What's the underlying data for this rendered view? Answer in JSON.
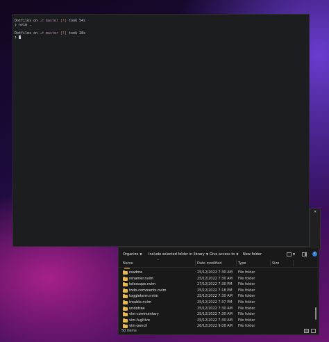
{
  "terminal": {
    "line1": {
      "dir": "Dotfiles",
      "on": " on ",
      "git": "⎇ master",
      "status": " [!]",
      "took": " took 54s"
    },
    "line2": {
      "prompt": "❯",
      "cmd": " nvim ."
    },
    "line3": {
      "dir": "Dotfiles",
      "on": " on ",
      "git": "⎇ master",
      "status": " [!]",
      "took": " took 28s"
    },
    "line4": {
      "prompt": "❯"
    }
  },
  "explorer": {
    "toolbar": {
      "organize": "Organize",
      "include": "Include selected folder in library",
      "share": "Give access to",
      "new_folder": "New folder"
    },
    "columns": {
      "name": "Name",
      "date": "Date modified",
      "type": "Type",
      "size": "Size"
    },
    "rows": [
      {
        "name": "readme",
        "date": "25/12/2022 7:30 AM",
        "type": "File folder"
      },
      {
        "name": "renamer.nvim",
        "date": "25/12/2022 7:30 AM",
        "type": "File folder"
      },
      {
        "name": "telescope.nvim",
        "date": "27/12/2022 7:30 PM",
        "type": "File folder"
      },
      {
        "name": "todo-comments.nvim",
        "date": "25/12/2022 7:18 PM",
        "type": "File folder"
      },
      {
        "name": "toggleterm.nvim",
        "date": "25/12/2022 7:30 AM",
        "type": "File folder"
      },
      {
        "name": "trouble.nvim",
        "date": "25/12/2022 7:37 PM",
        "type": "File folder"
      },
      {
        "name": "undotree",
        "date": "25/12/2022 7:30 AM",
        "type": "File folder"
      },
      {
        "name": "vim-commentary",
        "date": "25/12/2022 7:30 AM",
        "type": "File folder"
      },
      {
        "name": "vim-fugitive",
        "date": "25/12/2022 7:30 AM",
        "type": "File folder"
      },
      {
        "name": "vim-pencil",
        "date": "26/12/2022 9:08 AM",
        "type": "File folder"
      }
    ],
    "status": "50 items"
  },
  "back_window": {
    "close": "✕"
  },
  "colors": {
    "terminal_bg": "#1c1d1f",
    "explorer_bg": "#191919",
    "folder": "#e8b84a",
    "help": "#2f7fd8"
  }
}
